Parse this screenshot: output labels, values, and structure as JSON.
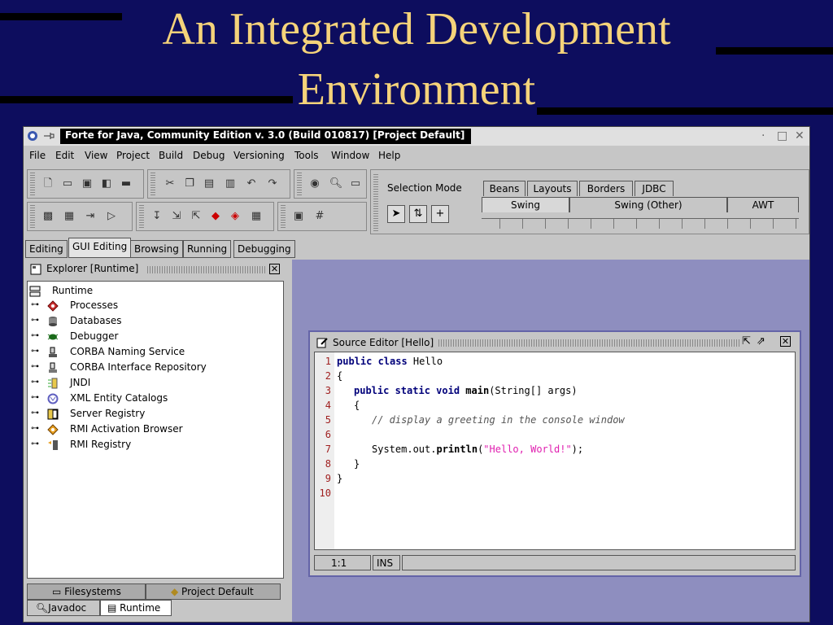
{
  "slide": {
    "title_line1": "An Integrated Development",
    "title_line2": "Environment"
  },
  "window": {
    "title": "Forte for Java, Community Edition v. 3.0 (Build 010817) [Project Default]",
    "controls": {
      "minimize": "·",
      "maximize": "□",
      "close": "✕"
    }
  },
  "menu": [
    "File",
    "Edit",
    "View",
    "Project",
    "Build",
    "Debug",
    "Versioning",
    "Tools",
    "Window",
    "Help"
  ],
  "palette": {
    "selection_mode_label": "Selection Mode",
    "top_tabs": [
      "Beans",
      "Layouts",
      "Borders",
      "JDBC"
    ],
    "bottom_tabs": [
      "Swing",
      "Swing (Other)",
      "AWT"
    ],
    "selected_tab": "Swing"
  },
  "workspace_tabs": [
    "Editing",
    "GUI Editing",
    "Browsing",
    "Running",
    "Debugging"
  ],
  "selected_workspace": "GUI Editing",
  "explorer": {
    "title": "Explorer [Runtime]",
    "root": "Runtime",
    "nodes": [
      "Processes",
      "Databases",
      "Debugger",
      "CORBA Naming Service",
      "CORBA Interface Repository",
      "JNDI",
      "XML Entity Catalogs",
      "Server Registry",
      "RMI Activation Browser",
      "RMI Registry"
    ],
    "bottom_tabs": {
      "filesystems": "Filesystems",
      "project": "Project Default",
      "javadoc": "Javadoc",
      "runtime": "Runtime"
    }
  },
  "source_editor": {
    "title": "Source Editor [Hello]",
    "line_numbers": [
      "1",
      "2",
      "3",
      "4",
      "5",
      "6",
      "7",
      "8",
      "9",
      "10"
    ],
    "code": {
      "l1_kw": "public class",
      "l1_rest": " Hello",
      "l2": "{",
      "l3_kw": "public static void",
      "l3_name": "main",
      "l3_rest": "(String[] args)",
      "l4": "{",
      "l5": "// display a greeting in the console window",
      "l7_pre": "System.out.",
      "l7_method": "println",
      "l7_open": "(",
      "l7_str": "\"Hello, World!\"",
      "l7_close": ");",
      "l8": "}",
      "l9": "}"
    },
    "status_position": "1:1",
    "status_mode": "INS"
  },
  "colors": {
    "slide_bg": "#0d0d5e",
    "title": "#f5d37a",
    "desktop": "#8e8ebf",
    "keyword": "#00007a",
    "string": "#e020b0"
  }
}
